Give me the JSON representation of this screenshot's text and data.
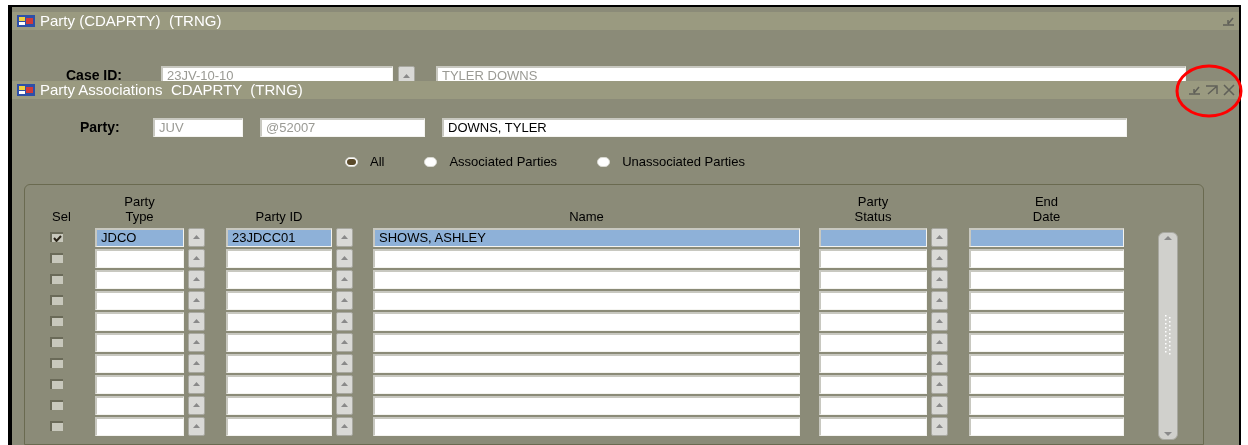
{
  "outer_window": {
    "title": "Party (CDAPRTY)  (TRNG)",
    "case": {
      "label": "Case ID:",
      "case_id": {
        "value": "23JV-10-10",
        "disabled": true
      },
      "case_name": {
        "value": "TYLER DOWNS",
        "disabled": true
      }
    }
  },
  "inner_window": {
    "title": "Party Associations  CDAPRTY  (TRNG)",
    "party": {
      "label": "Party:",
      "type": {
        "value": "JUV",
        "disabled": true
      },
      "id": {
        "value": "@52007",
        "disabled": true
      },
      "name": {
        "value": "DOWNS, TYLER",
        "disabled": false
      }
    },
    "filter_options": [
      {
        "label": "All",
        "selected": true
      },
      {
        "label": "Associated Parties",
        "selected": false
      },
      {
        "label": "Unassociated Parties",
        "selected": false
      }
    ],
    "table": {
      "columns": [
        "Sel",
        "Party Type",
        "Party ID",
        "Name",
        "Party Status",
        "End Date"
      ],
      "rows": [
        {
          "checked": true,
          "selected": true,
          "party_type": "JDCO",
          "party_id": "23JDCC01",
          "name": "SHOWS, ASHLEY"
        },
        {
          "checked": false,
          "selected": false
        },
        {
          "checked": false,
          "selected": false
        },
        {
          "checked": false,
          "selected": false
        },
        {
          "checked": false,
          "selected": false
        },
        {
          "checked": false,
          "selected": false
        },
        {
          "checked": false,
          "selected": false
        },
        {
          "checked": false,
          "selected": false
        },
        {
          "checked": false,
          "selected": false
        },
        {
          "checked": false,
          "selected": false
        }
      ]
    }
  }
}
